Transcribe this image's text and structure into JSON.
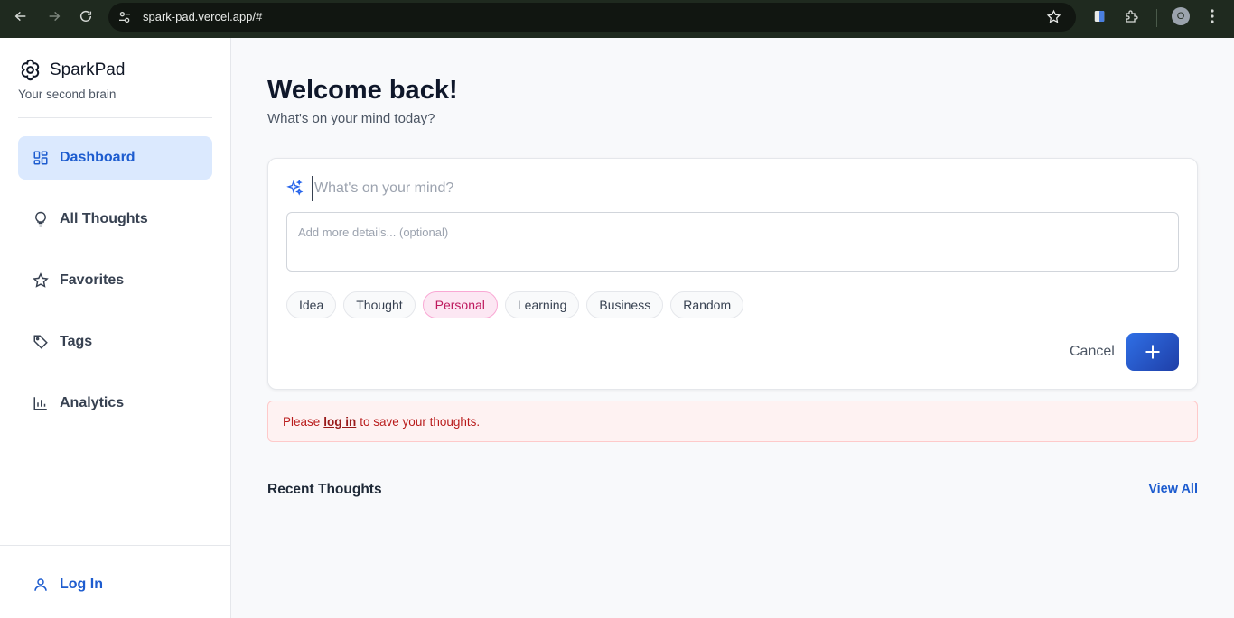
{
  "browser": {
    "url": "spark-pad.vercel.app/#",
    "profile_initial": "O",
    "icons": [
      "back-arrow-icon",
      "forward-arrow-icon",
      "reload-icon",
      "site-settings-icon",
      "bookmark-star-icon",
      "extension-icon",
      "puzzle-icon",
      "kebab-menu-icon"
    ]
  },
  "sidebar": {
    "brand": "SparkPad",
    "tagline": "Your second brain",
    "items": [
      {
        "label": "Dashboard",
        "icon": "dashboard-icon",
        "active": true
      },
      {
        "label": "All Thoughts",
        "icon": "lightbulb-icon",
        "active": false
      },
      {
        "label": "Favorites",
        "icon": "star-icon",
        "active": false
      },
      {
        "label": "Tags",
        "icon": "tag-icon",
        "active": false
      },
      {
        "label": "Analytics",
        "icon": "bar-chart-icon",
        "active": false
      }
    ],
    "login_label": "Log In"
  },
  "main": {
    "welcome": "Welcome back!",
    "subtitle": "What's on your mind today?",
    "composer": {
      "title_placeholder": "What's on your mind?",
      "details_placeholder": "Add more details... (optional)",
      "tags": [
        "Idea",
        "Thought",
        "Personal",
        "Learning",
        "Business",
        "Random"
      ],
      "selected_tag": "Personal",
      "cancel_label": "Cancel"
    },
    "alert": {
      "prefix": "Please",
      "link": "log in",
      "suffix": "to save your thoughts."
    },
    "recent_title": "Recent Thoughts",
    "view_all": "View All"
  },
  "colors": {
    "accent": "#1d5ccf",
    "active_bg": "#dbe9fe",
    "selected_tag_bg": "#fce7f3",
    "alert_text": "#b91c1c"
  }
}
